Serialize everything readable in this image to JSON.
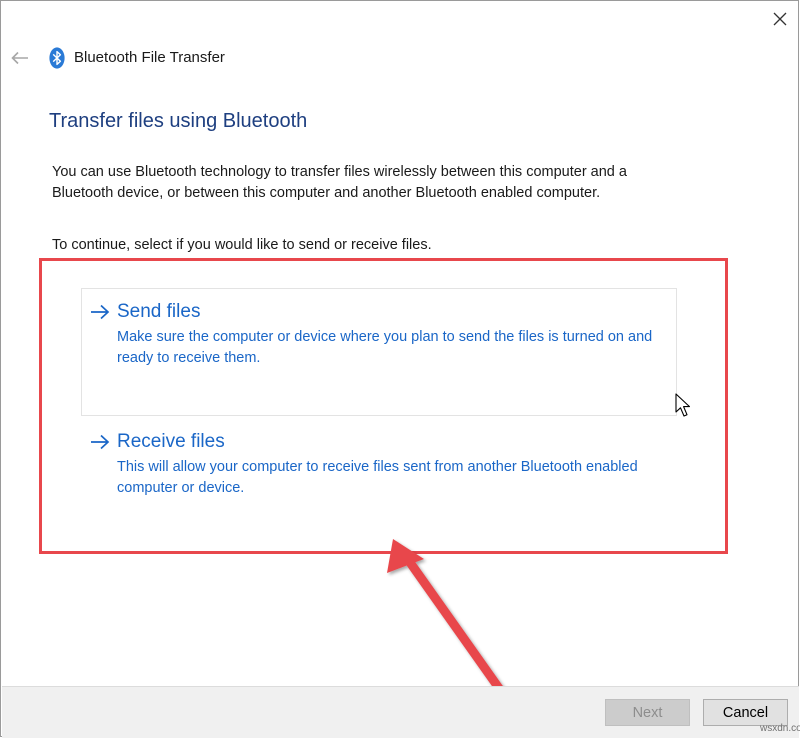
{
  "window": {
    "title": "Bluetooth File Transfer",
    "close_icon": "close-icon",
    "back_icon": "back-arrow-icon",
    "app_icon": "bluetooth-icon"
  },
  "page": {
    "heading": "Transfer files using Bluetooth",
    "description": "You can use Bluetooth technology to transfer files wirelessly between this computer and a Bluetooth device, or between this computer and another Bluetooth enabled computer.",
    "instruction": "To continue, select if you would like to send or receive files."
  },
  "options": [
    {
      "title": "Send files",
      "description": "Make sure the computer or device where you plan to send the files is turned on and ready to receive them."
    },
    {
      "title": "Receive files",
      "description": "This will allow your computer to receive files sent from another Bluetooth enabled computer or device."
    }
  ],
  "footer": {
    "next_label": "Next",
    "cancel_label": "Cancel",
    "next_enabled": false
  },
  "annotation": {
    "highlight_color": "#e8474c",
    "arrow_color": "#e8474c"
  },
  "colors": {
    "heading": "#1e3f80",
    "link": "#1a66c7",
    "footer_bg": "#f0f0f0"
  },
  "watermark": "wsxdn.com"
}
